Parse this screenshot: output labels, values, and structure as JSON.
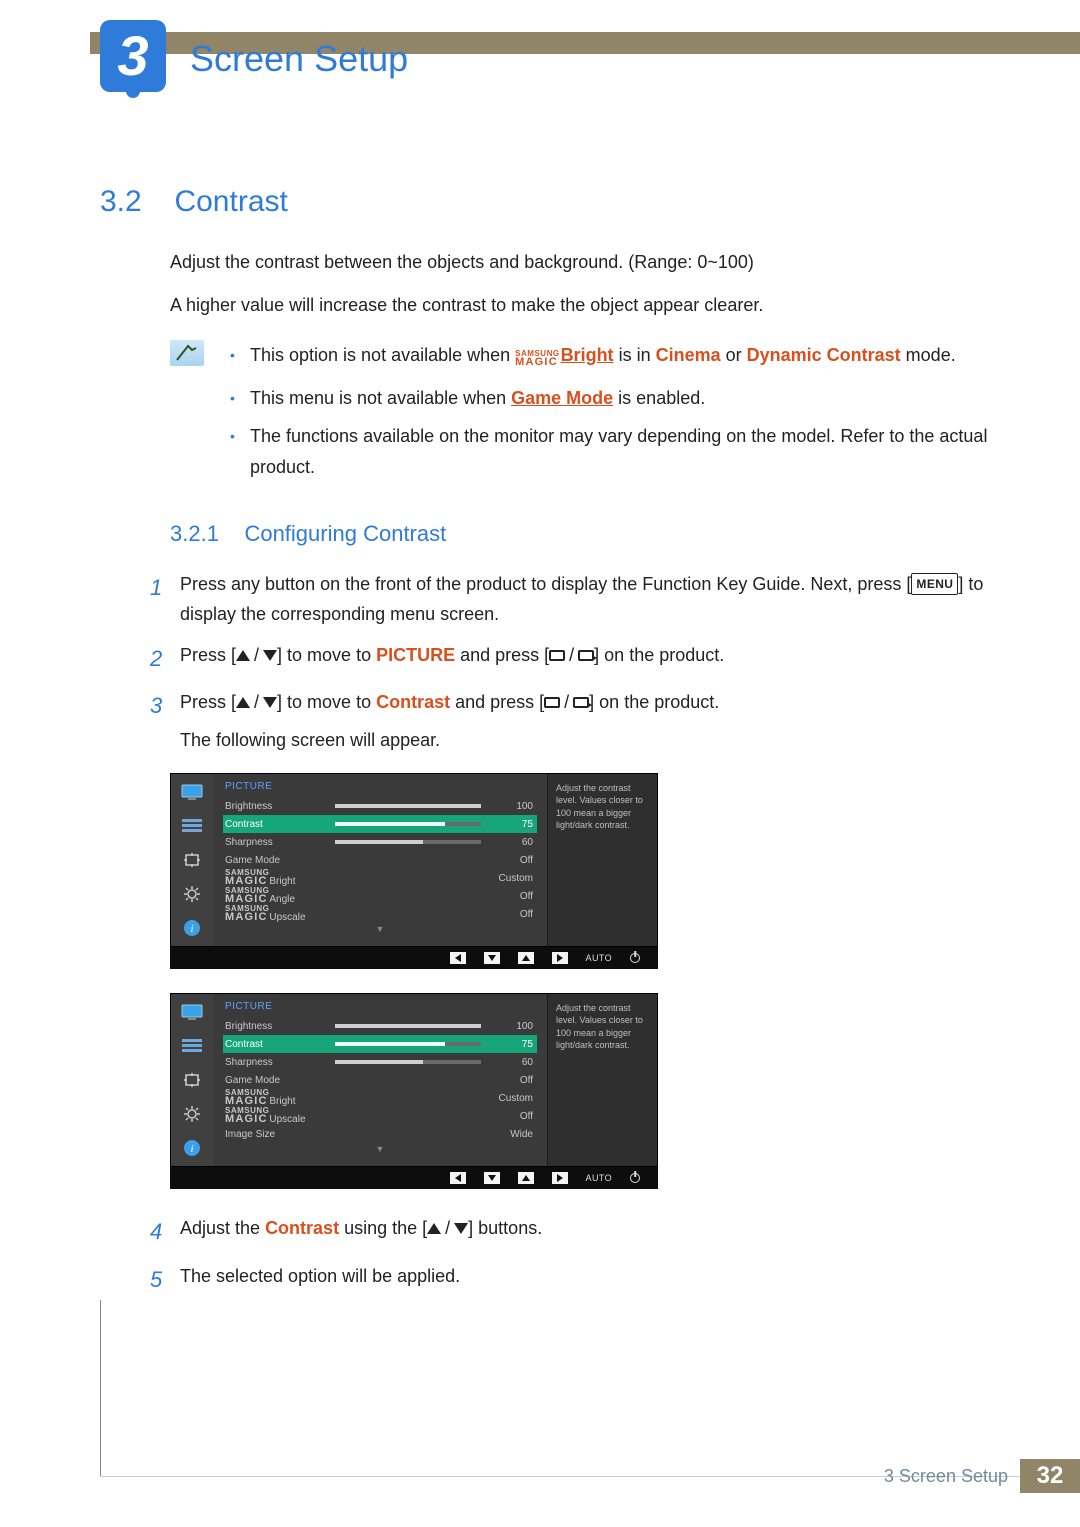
{
  "header": {
    "chapter_number": "3",
    "chapter_title": "Screen Setup"
  },
  "section": {
    "number": "3.2",
    "title": "Contrast",
    "intro1": "Adjust the contrast between the objects and background. (Range: 0~100)",
    "intro2": "A higher value will increase the contrast to make the object appear clearer."
  },
  "notes": {
    "n1_pre": "This option is not available when ",
    "n1_mid": " is in ",
    "n1_cinema": "Cinema",
    "n1_or": " or ",
    "n1_dc": "Dynamic Contrast",
    "n1_post": " mode.",
    "magic_bright_label": "Bright",
    "n2_pre": "This menu is not available when ",
    "n2_gm": "Game Mode",
    "n2_post": " is enabled.",
    "n3": "The functions available on the monitor may vary depending on the model. Refer to the actual product."
  },
  "subsection": {
    "number": "3.2.1",
    "title": "Configuring Contrast"
  },
  "steps": {
    "s1a": "Press any button on the front of the product to display the Function Key Guide. Next, press [",
    "s1_menu": "MENU",
    "s1b": "] to display the corresponding menu screen.",
    "s2a": "Press [",
    "s2b": "] to move to ",
    "s2_pic": "PICTURE",
    "s2c": " and press [",
    "s2d": "] on the product.",
    "s3a": "Press [",
    "s3b": "] to move to ",
    "s3_con": "Contrast",
    "s3c": " and press [",
    "s3d": "] on the product.",
    "s3e": "The following screen will appear.",
    "s4a": "Adjust the ",
    "s4_con": "Contrast",
    "s4b": " using the [",
    "s4c": "] buttons.",
    "s5": "The selected option will be applied."
  },
  "osd": {
    "title": "PICTURE",
    "help": "Adjust the contrast level. Values closer to 100 mean a bigger light/dark contrast.",
    "bottom_auto": "AUTO",
    "magic_prefix_top": "SAMSUNG",
    "magic_prefix_bot": "MAGIC",
    "rows_a": [
      {
        "name": "Brightness",
        "val": "100",
        "bar": 100
      },
      {
        "name": "Contrast",
        "val": "75",
        "bar": 75,
        "sel": true
      },
      {
        "name": "Sharpness",
        "val": "60",
        "bar": 60
      },
      {
        "name": "Game Mode",
        "val": "Off"
      },
      {
        "name": "Bright",
        "val": "Custom",
        "magic": true
      },
      {
        "name": "Angle",
        "val": "Off",
        "magic": true
      },
      {
        "name": "Upscale",
        "val": "Off",
        "magic": true
      }
    ],
    "rows_b": [
      {
        "name": "Brightness",
        "val": "100",
        "bar": 100
      },
      {
        "name": "Contrast",
        "val": "75",
        "bar": 75,
        "sel": true
      },
      {
        "name": "Sharpness",
        "val": "60",
        "bar": 60
      },
      {
        "name": "Game Mode",
        "val": "Off"
      },
      {
        "name": "Bright",
        "val": "Custom",
        "magic": true
      },
      {
        "name": "Upscale",
        "val": "Off",
        "magic": true
      },
      {
        "name": "Image Size",
        "val": "Wide"
      }
    ]
  },
  "footer": {
    "label": "3 Screen Setup",
    "page": "32"
  }
}
